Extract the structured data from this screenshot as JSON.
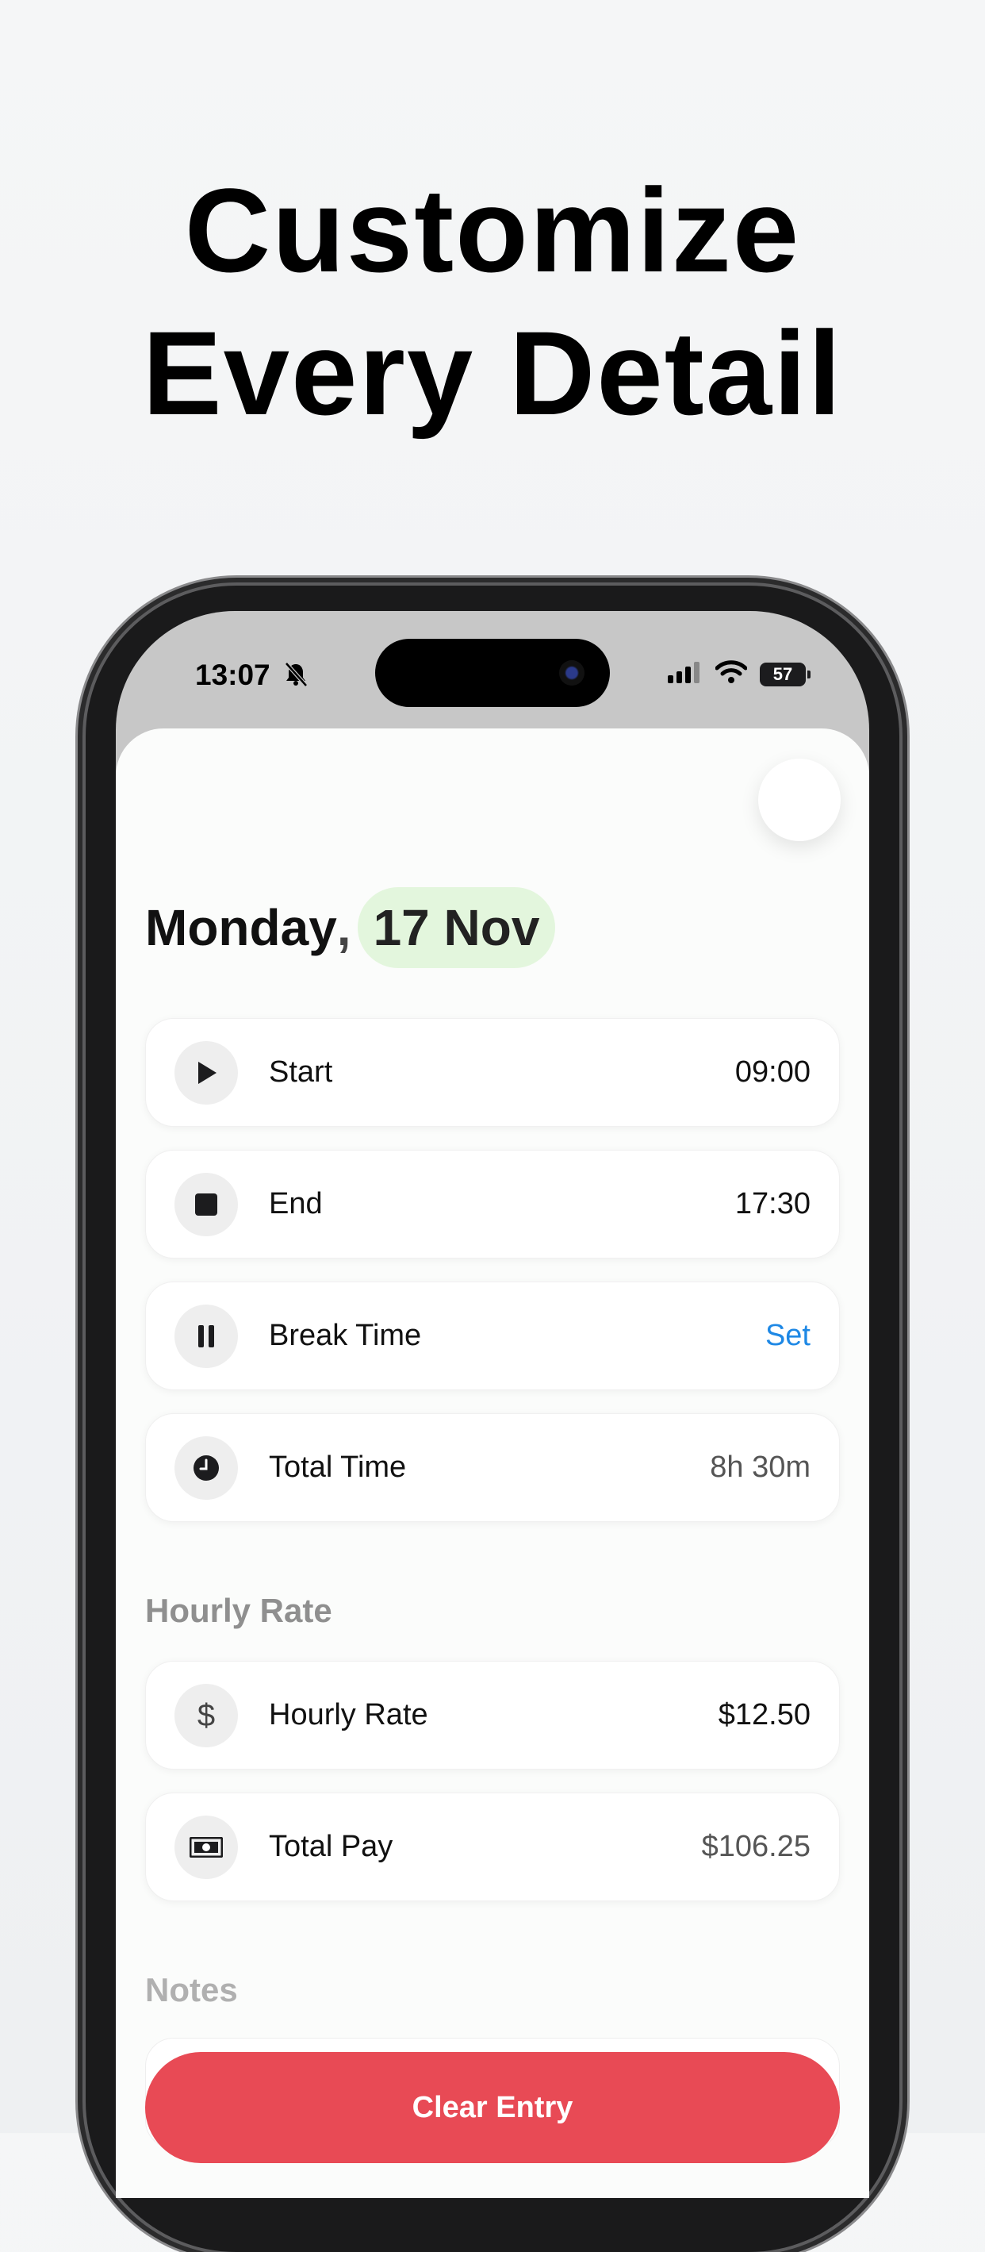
{
  "headline": {
    "line1": "Customize",
    "line2": "Every Detail"
  },
  "status_bar": {
    "time": "13:07",
    "battery": "57"
  },
  "date_header": {
    "weekday": "Monday",
    "comma": ",",
    "date": "17 Nov"
  },
  "rows": {
    "start": {
      "label": "Start",
      "value": "09:00"
    },
    "end": {
      "label": "End",
      "value": "17:30"
    },
    "break": {
      "label": "Break Time",
      "value": "Set"
    },
    "total_time": {
      "label": "Total Time",
      "value": "8h 30m"
    },
    "hourly_rate": {
      "label": "Hourly Rate",
      "value": "$12.50"
    },
    "total_pay": {
      "label": "Total Pay",
      "value": "$106.25"
    }
  },
  "sections": {
    "hourly_rate": "Hourly Rate",
    "notes": "Notes"
  },
  "actions": {
    "clear_entry": "Clear Entry"
  },
  "colors": {
    "accent_link": "#1e88e5",
    "danger": "#e84a55",
    "date_pill": "#e3f6dd"
  },
  "icons": {
    "start": "play-icon",
    "end": "stop-icon",
    "break": "pause-icon",
    "total_time": "clock-icon",
    "hourly_rate": "dollar-icon",
    "total_pay": "banknote-icon"
  }
}
